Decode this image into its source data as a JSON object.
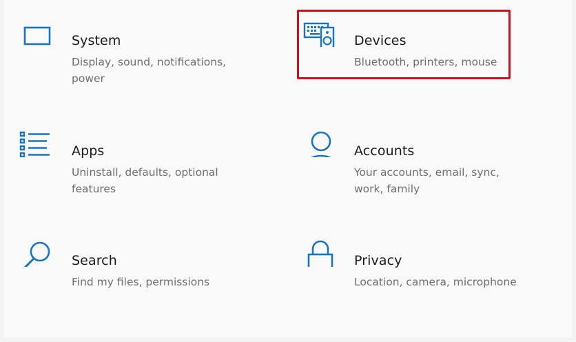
{
  "colors": {
    "accent": "#1a73c1",
    "title": "#1a1a1a",
    "description": "#6e6e6e",
    "highlight": "#c7131b",
    "background": "#f9f9f9"
  },
  "tiles": [
    {
      "id": "system",
      "icon": "laptop-icon",
      "title": "System",
      "description": "Display, sound, notifications, power"
    },
    {
      "id": "devices",
      "icon": "devices-icon",
      "title": "Devices",
      "description": "Bluetooth, printers, mouse",
      "highlighted": true
    },
    {
      "id": "apps",
      "icon": "apps-list-icon",
      "title": "Apps",
      "description": "Uninstall, defaults, optional features"
    },
    {
      "id": "accounts",
      "icon": "person-icon",
      "title": "Accounts",
      "description": "Your accounts, email, sync, work, family"
    },
    {
      "id": "search",
      "icon": "search-icon",
      "title": "Search",
      "description": "Find my files, permissions"
    },
    {
      "id": "privacy",
      "icon": "lock-icon",
      "title": "Privacy",
      "description": "Location, camera, microphone"
    }
  ]
}
